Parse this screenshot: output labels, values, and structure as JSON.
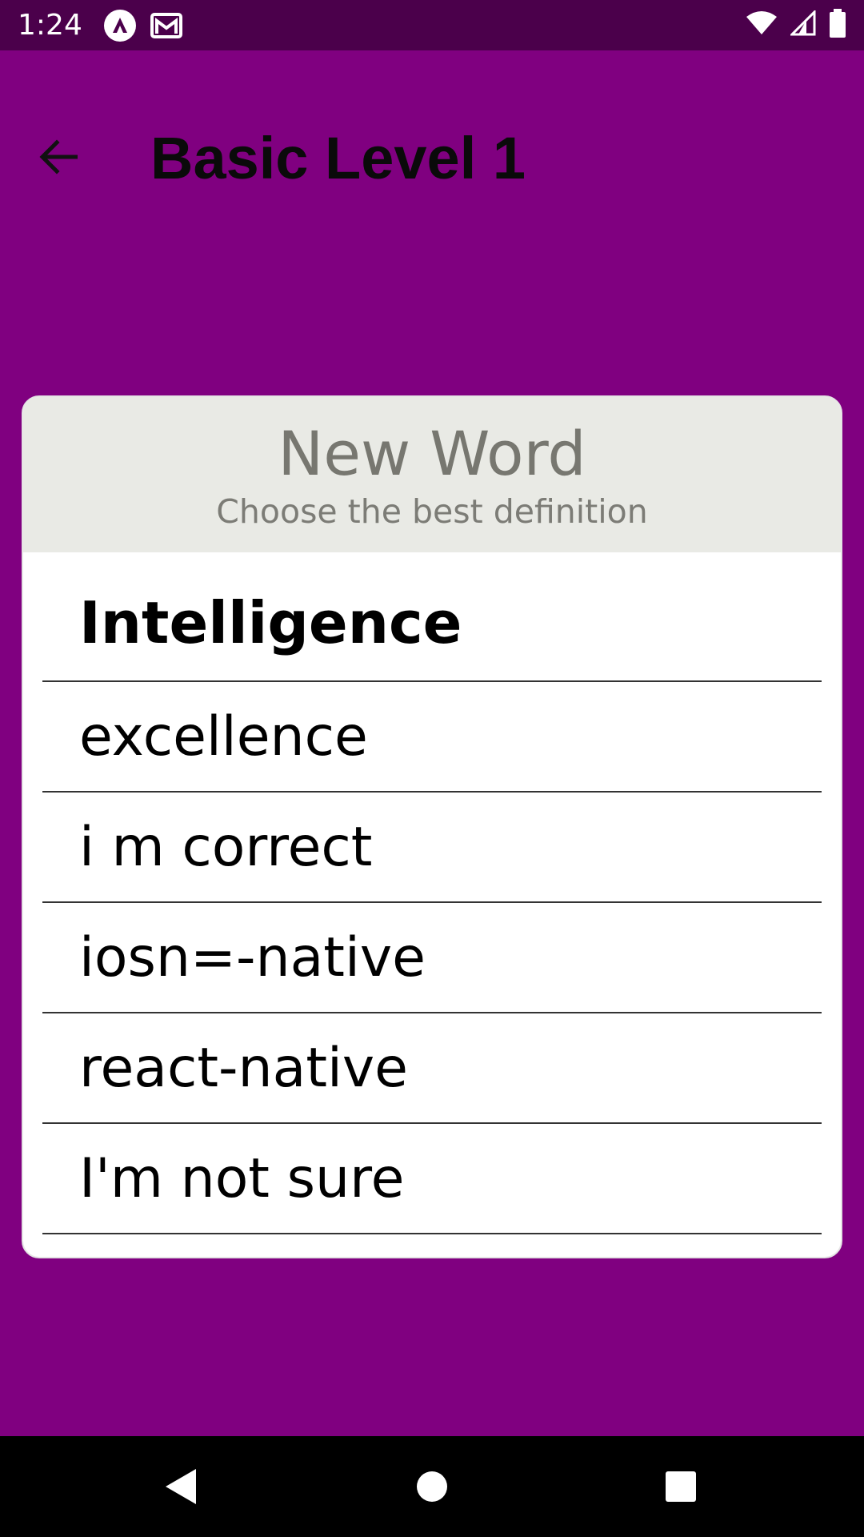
{
  "status_bar": {
    "time": "1:24",
    "icons_left": [
      "app-a-icon",
      "gmail-icon"
    ],
    "icons_right": [
      "wifi-icon",
      "signal-icon",
      "battery-icon"
    ]
  },
  "header": {
    "back_icon": "arrow-back-icon",
    "title": "Basic Level 1"
  },
  "card": {
    "title": "New Word",
    "subtitle": "Choose the best definition",
    "word": "Intelligence",
    "options": [
      "excellence",
      "i m correct",
      "iosn=-native",
      "react-native",
      "I'm not sure"
    ]
  },
  "nav_bar": {
    "buttons": [
      "back-triangle-icon",
      "home-circle-icon",
      "recents-square-icon"
    ]
  },
  "colors": {
    "background": "#800080",
    "status_bar": "#4b004b",
    "card_header": "#e9eae5",
    "card_title_text": "#777770"
  }
}
